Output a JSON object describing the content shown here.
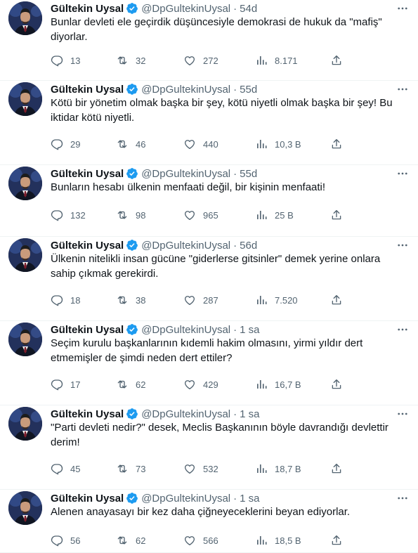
{
  "author": {
    "name": "Gültekin Uysal",
    "handle": "@DpGultekinUysal"
  },
  "tweets": [
    {
      "time": "54d",
      "text": "Bunlar devleti ele geçirdik düşüncesiyle demokrasi de hukuk da \"mafiş\" diyorlar.",
      "replies": "13",
      "retweets": "32",
      "likes": "272",
      "views": "8.171"
    },
    {
      "time": "55d",
      "text": "Kötü bir yönetim olmak başka bir şey, kötü niyetli olmak başka bir şey! Bu iktidar kötü niyetli.",
      "replies": "29",
      "retweets": "46",
      "likes": "440",
      "views": "10,3 B"
    },
    {
      "time": "55d",
      "text": "Bunların hesabı ülkenin menfaati değil, bir kişinin menfaati!",
      "replies": "132",
      "retweets": "98",
      "likes": "965",
      "views": "25 B"
    },
    {
      "time": "56d",
      "text": "Ülkenin nitelikli insan gücüne \"giderlerse gitsinler\" demek yerine onlara sahip çıkmak gerekirdi.",
      "replies": "18",
      "retweets": "38",
      "likes": "287",
      "views": "7.520"
    },
    {
      "time": "1 sa",
      "text": "Seçim kurulu başkanlarının kıdemli hakim olmasını, yirmi yıldır dert etmemişler de şimdi neden dert ettiler?",
      "replies": "17",
      "retweets": "62",
      "likes": "429",
      "views": "16,7 B"
    },
    {
      "time": "1 sa",
      "text": "\"Parti devleti nedir?\" desek, Meclis Başkanının böyle davrandığı devlettir derim!",
      "replies": "45",
      "retweets": "73",
      "likes": "532",
      "views": "18,7 B"
    },
    {
      "time": "1 sa",
      "text": "Alenen anayasayı bir kez daha çiğneyeceklerini beyan ediyorlar.",
      "replies": "56",
      "retweets": "62",
      "likes": "566",
      "views": "18,5 B"
    }
  ],
  "icons": {
    "verified": "verified-badge-icon",
    "more": "more-options-icon",
    "reply": "reply-icon",
    "retweet": "retweet-icon",
    "like": "like-icon",
    "views": "views-icon",
    "share": "share-icon"
  },
  "colors": {
    "text": "#0f1419",
    "secondary": "#536471",
    "verified": "#1d9bf0",
    "divider": "#eff3f4"
  }
}
